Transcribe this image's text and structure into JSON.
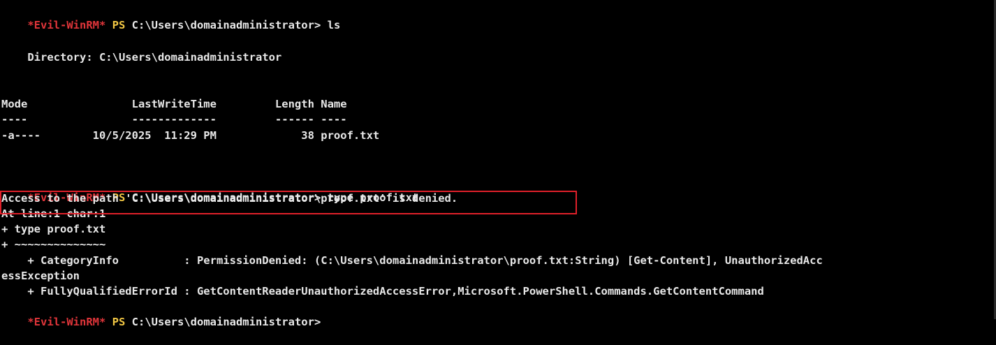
{
  "terminal": {
    "prompt_prefix": "*Evil-WinRM*",
    "prompt_ps": "PS",
    "prompt_path": "C:\\Users\\domainadministrator>",
    "commands": {
      "ls": "ls",
      "type": "type proof.txt"
    },
    "directory_line": "    Directory: C:\\Users\\domainadministrator",
    "table": {
      "header": "Mode                LastWriteTime         Length Name",
      "underline": "----                -------------         ------ ----",
      "rows": [
        "-a----        10/5/2025  11:29 PM             38 proof.txt"
      ]
    },
    "error": {
      "message": "Access to the path 'C:\\Users\\domainadministrator\\proof.txt' is denied.",
      "at_line": "At line:1 char:1",
      "command_echo": "+ type proof.txt",
      "tilde_line": "+ ~~~~~~~~~~~~~~",
      "category_info_1": "    + CategoryInfo          : PermissionDenied: (C:\\Users\\domainadministrator\\proof.txt:String) [Get-Content], UnauthorizedAcc",
      "category_info_2": "essException",
      "fq_error_id": "    + FullyQualifiedErrorId : GetContentReaderUnauthorizedAccessError,Microsoft.PowerShell.Commands.GetContentCommand"
    },
    "colors": {
      "background": "#000000",
      "prompt_red": "#e0353a",
      "ps_yellow": "#f2c744",
      "text": "#e8e8e8",
      "annotation_box": "#e0202a"
    }
  }
}
